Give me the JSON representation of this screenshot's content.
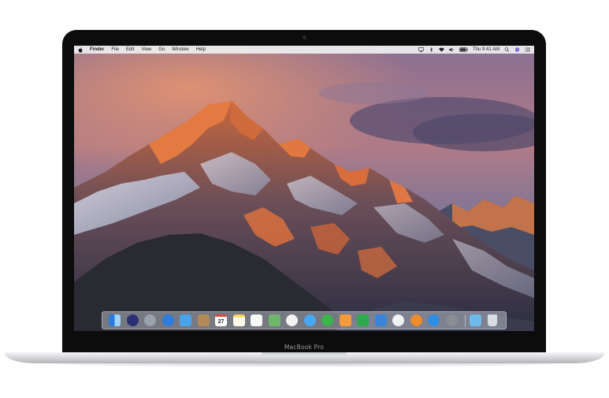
{
  "device": {
    "model_label": "MacBook Pro"
  },
  "menubar": {
    "apple_icon": "apple-icon",
    "app_name": "Finder",
    "menus": [
      "File",
      "Edit",
      "View",
      "Go",
      "Window",
      "Help"
    ],
    "status_icons": [
      "airplay-icon",
      "bluetooth-icon",
      "wifi-icon",
      "volume-icon",
      "battery-icon"
    ],
    "clock": "Thu 9:41 AM",
    "search_icon": "spotlight-icon",
    "siri_icon": "siri-icon",
    "notification_icon": "notification-center-icon"
  },
  "dock": {
    "apps": [
      {
        "name": "finder",
        "color": "#3b8fe0"
      },
      {
        "name": "siri",
        "color": "#2b2f74"
      },
      {
        "name": "launchpad",
        "color": "#9aa2ad"
      },
      {
        "name": "safari",
        "color": "#2f7de1"
      },
      {
        "name": "mail",
        "color": "#4aa3e8"
      },
      {
        "name": "contacts",
        "color": "#b38a57"
      },
      {
        "name": "calendar",
        "color": "#ffffff"
      },
      {
        "name": "notes",
        "color": "#f5d95a"
      },
      {
        "name": "reminders",
        "color": "#f7f7f7"
      },
      {
        "name": "maps",
        "color": "#6db76a"
      },
      {
        "name": "photos",
        "color": "#f2f2f2"
      },
      {
        "name": "messages",
        "color": "#49a8f3"
      },
      {
        "name": "facetime",
        "color": "#3ab54a"
      },
      {
        "name": "pages",
        "color": "#f39a3b"
      },
      {
        "name": "numbers",
        "color": "#2eaa4e"
      },
      {
        "name": "keynote",
        "color": "#3b84d8"
      },
      {
        "name": "itunes",
        "color": "#f2f2f4"
      },
      {
        "name": "ibooks",
        "color": "#f08a2a"
      },
      {
        "name": "app-store",
        "color": "#2f8de4"
      },
      {
        "name": "system-preferences",
        "color": "#8a8d93"
      },
      {
        "name": "downloads-folder",
        "color": "#6cb9ea"
      },
      {
        "name": "trash",
        "color": "#d8dde3"
      }
    ],
    "calendar_day": "27"
  }
}
